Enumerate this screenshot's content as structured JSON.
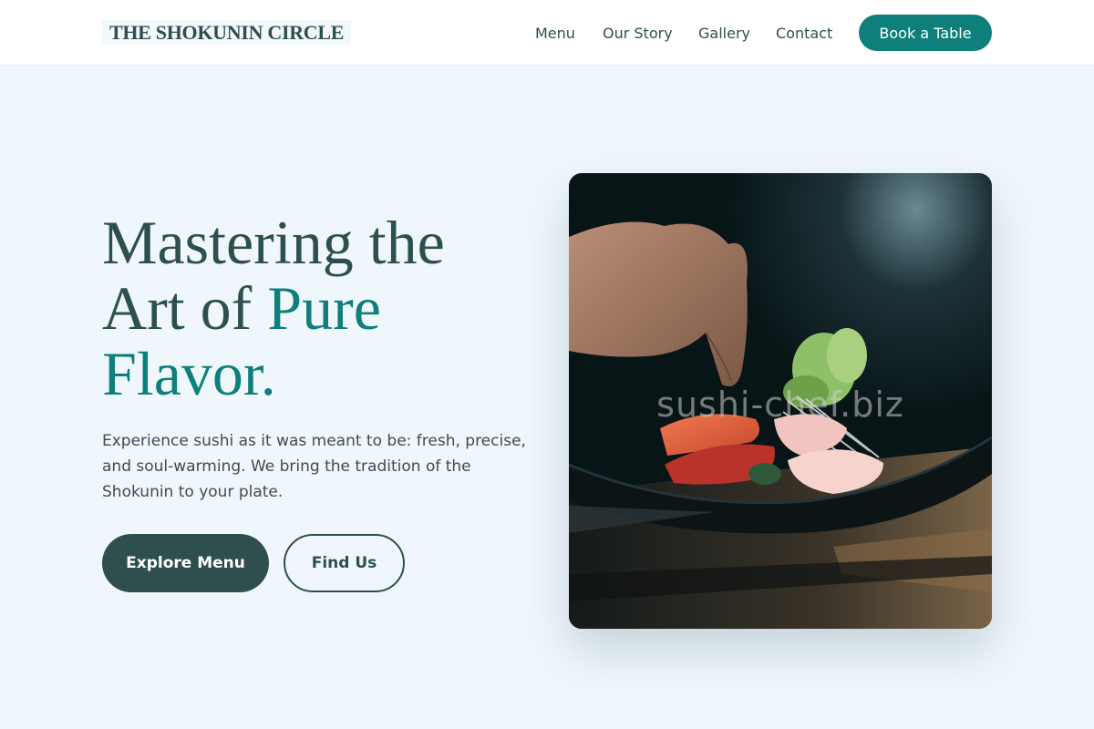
{
  "header": {
    "logo": "THE SHOKUNIN CIRCLE",
    "nav": {
      "menu": "Menu",
      "story": "Our Story",
      "gallery": "Gallery",
      "contact": "Contact"
    },
    "cta": "Book a Table"
  },
  "hero": {
    "title_line1": "Mastering the",
    "title_line2_plain": "Art of ",
    "title_accent": "Pure Flavor.",
    "description": "Experience sushi as it was meant to be: fresh, precise, and soul-warming. We bring the tradition of the Shokunin to your plate.",
    "primary_button": "Explore Menu",
    "secondary_button": "Find Us",
    "image_watermark": "sushi-chef.biz"
  },
  "colors": {
    "primary_dark": "#2f4f4f",
    "accent_teal": "#0e7f7a",
    "background": "#eff7fc"
  }
}
